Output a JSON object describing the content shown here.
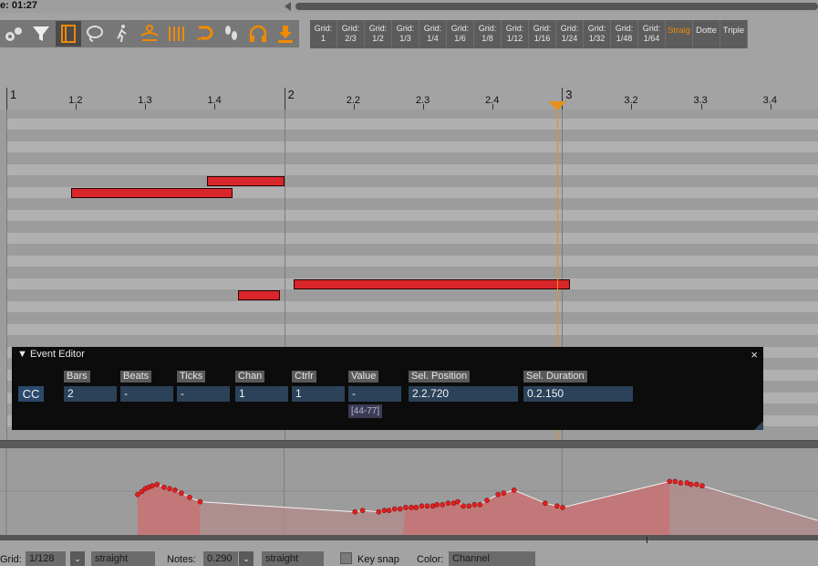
{
  "window": {
    "time_label": "e: 01:27"
  },
  "toolbar": {
    "tools": [
      {
        "name": "edit-tool-icon",
        "active": false
      },
      {
        "name": "filter-icon",
        "active": false
      },
      {
        "name": "note-view-icon",
        "active": true
      },
      {
        "name": "lasso-icon",
        "active": false
      },
      {
        "name": "walk-icon",
        "active": false
      },
      {
        "name": "link-icon",
        "active": false
      },
      {
        "name": "grid-lines-icon",
        "active": false
      },
      {
        "name": "loop-icon",
        "active": false
      },
      {
        "name": "steps-icon",
        "active": false
      },
      {
        "name": "headphones-icon",
        "active": false
      },
      {
        "name": "download-icon",
        "active": false
      }
    ],
    "grid_buttons": [
      {
        "l1": "Grid:",
        "l2": "1"
      },
      {
        "l1": "Grid:",
        "l2": "2/3"
      },
      {
        "l1": "Grid:",
        "l2": "1/2"
      },
      {
        "l1": "Grid:",
        "l2": "1/3"
      },
      {
        "l1": "Grid:",
        "l2": "1/4"
      },
      {
        "l1": "Grid:",
        "l2": "1/6"
      },
      {
        "l1": "Grid:",
        "l2": "1/8"
      },
      {
        "l1": "Grid:",
        "l2": "1/12"
      },
      {
        "l1": "Grid:",
        "l2": "1/16"
      },
      {
        "l1": "Grid:",
        "l2": "1/24"
      },
      {
        "l1": "Grid:",
        "l2": "1/32"
      },
      {
        "l1": "Grid:",
        "l2": "1/48"
      },
      {
        "l1": "Grid:",
        "l2": "1/64"
      }
    ],
    "mode_buttons": [
      {
        "label": "Straig",
        "active": true
      },
      {
        "label": "Dotte",
        "active": false
      },
      {
        "label": "Triple",
        "active": false
      }
    ],
    "accent_color": "#f08a00"
  },
  "ruler": {
    "labels": [
      {
        "text": "1",
        "beat": 0,
        "major": true
      },
      {
        "text": "1.2",
        "beat": 1,
        "major": false
      },
      {
        "text": "1.3",
        "beat": 2,
        "major": false
      },
      {
        "text": "1.4",
        "beat": 3,
        "major": false
      },
      {
        "text": "2",
        "beat": 4,
        "major": true
      },
      {
        "text": "2.2",
        "beat": 5,
        "major": false
      },
      {
        "text": "2.3",
        "beat": 6,
        "major": false
      },
      {
        "text": "2.4",
        "beat": 7,
        "major": false
      },
      {
        "text": "3",
        "beat": 8,
        "major": true
      },
      {
        "text": "3.2",
        "beat": 9,
        "major": false
      },
      {
        "text": "3.3",
        "beat": 10,
        "major": false
      },
      {
        "text": "3.4",
        "beat": 11,
        "major": false
      }
    ]
  },
  "notes": [
    {
      "start_beat": 2.89,
      "length_beats": 1.12,
      "pitch_row": 6
    },
    {
      "start_beat": 0.93,
      "length_beats": 2.33,
      "pitch_row": 7
    },
    {
      "start_beat": 4.14,
      "length_beats": 3.98,
      "pitch_row": 15
    },
    {
      "start_beat": 3.33,
      "length_beats": 0.61,
      "pitch_row": 16
    }
  ],
  "note_color": "#d9262a",
  "playhead_beat": 7.93,
  "event_editor": {
    "title": "▼ Event Editor",
    "close": "×",
    "type_label": "CC",
    "columns": [
      {
        "header": "Bars",
        "value": "2"
      },
      {
        "header": "Beats",
        "value": "-"
      },
      {
        "header": "Ticks",
        "value": "-"
      },
      {
        "header": "Chan",
        "value": "1"
      },
      {
        "header": "Ctrlr",
        "value": "1"
      },
      {
        "header": "Value",
        "value": "-"
      },
      {
        "header": "Sel. Position",
        "value": "2.2.720"
      },
      {
        "header": "Sel. Duration",
        "value": "0.2.150"
      }
    ],
    "value_range": "[44-77]"
  },
  "cc_lane": {
    "points": [
      [
        1.89,
        28
      ],
      [
        1.95,
        30
      ],
      [
        2.0,
        32
      ],
      [
        2.05,
        33
      ],
      [
        2.1,
        34
      ],
      [
        2.17,
        35
      ],
      [
        2.27,
        33
      ],
      [
        2.35,
        32
      ],
      [
        2.43,
        31
      ],
      [
        2.52,
        29
      ],
      [
        2.64,
        26
      ],
      [
        2.79,
        23
      ],
      [
        5.02,
        16
      ],
      [
        5.13,
        17
      ],
      [
        5.36,
        16
      ],
      [
        5.44,
        17
      ],
      [
        5.51,
        17
      ],
      [
        5.59,
        18
      ],
      [
        5.67,
        18
      ],
      [
        5.75,
        19
      ],
      [
        5.83,
        19
      ],
      [
        5.9,
        19
      ],
      [
        5.98,
        20
      ],
      [
        6.06,
        20
      ],
      [
        6.14,
        20
      ],
      [
        6.2,
        21
      ],
      [
        6.28,
        21
      ],
      [
        6.36,
        22
      ],
      [
        6.44,
        22
      ],
      [
        6.5,
        23
      ],
      [
        6.58,
        20
      ],
      [
        6.66,
        20
      ],
      [
        6.74,
        21
      ],
      [
        6.82,
        21
      ],
      [
        6.92,
        24
      ],
      [
        7.08,
        28
      ],
      [
        7.16,
        29
      ],
      [
        7.31,
        31
      ],
      [
        7.76,
        22
      ],
      [
        7.93,
        20
      ],
      [
        8.01,
        19
      ],
      [
        9.55,
        37
      ],
      [
        9.63,
        37
      ],
      [
        9.71,
        36
      ],
      [
        9.8,
        36
      ],
      [
        9.86,
        35
      ],
      [
        9.94,
        35
      ],
      [
        10.02,
        34
      ]
    ],
    "filled_ranges": [
      [
        1.89,
        4.0
      ],
      [
        5.71,
        9.55
      ]
    ],
    "line_color": "#f2f2f2",
    "fill_color": "#c87070",
    "dot_color": "#e02020"
  },
  "status": {
    "grid_label": "Grid:",
    "grid_value": "1/128",
    "grid_mode": "straight",
    "notes_label": "Notes:",
    "notes_value": "0.290",
    "notes_mode": "straight",
    "keysnap_label": "Key snap",
    "color_label": "Color:",
    "color_value": "Channel"
  }
}
